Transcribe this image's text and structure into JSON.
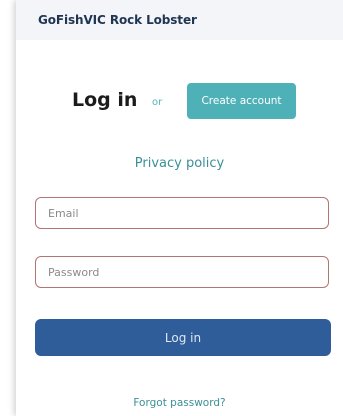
{
  "header": {
    "title": "GoFishVIC Rock Lobster"
  },
  "login": {
    "heading": "Log in",
    "or_text": "or",
    "create_account_label": "Create account",
    "privacy_link": "Privacy policy",
    "email_placeholder": "Email",
    "password_placeholder": "Password",
    "submit_label": "Log in",
    "forgot_link": "Forgot password?"
  },
  "colors": {
    "header_background": "#f3f5f8",
    "header_text": "#1f3551",
    "teal_accent": "#4fb1b8",
    "link_teal": "#3b8f96",
    "primary_button": "#2e5d99",
    "input_border": "#b37474"
  }
}
